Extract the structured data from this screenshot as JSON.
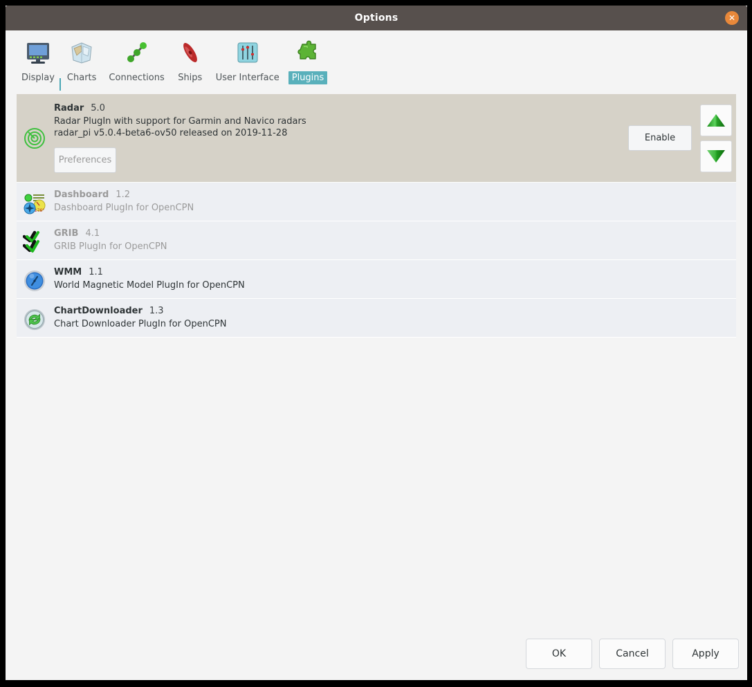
{
  "window": {
    "title": "Options",
    "close_label": "✕"
  },
  "toolbar": {
    "tabs": [
      {
        "label": "Display",
        "icon": "monitor-icon",
        "selected": false
      },
      {
        "label": "Charts",
        "icon": "charts-icon",
        "selected": false
      },
      {
        "label": "Connections",
        "icon": "connections-icon",
        "selected": false
      },
      {
        "label": "Ships",
        "icon": "ship-icon",
        "selected": false
      },
      {
        "label": "User Interface",
        "icon": "sliders-icon",
        "selected": false
      },
      {
        "label": "Plugins",
        "icon": "puzzle-piece-icon",
        "selected": true
      }
    ]
  },
  "plugins": [
    {
      "name": "Radar",
      "version": "5.0",
      "description": "Radar PlugIn with support for Garmin and Navico radars",
      "detail": "radar_pi v5.0.4-beta6-ov50 released on 2019-11-28",
      "icon": "radar-icon",
      "expanded": true,
      "enabled": false,
      "preferences_label": "Preferences",
      "preferences_enabled": false,
      "toggle_label": "Enable",
      "move_up_label": "▲",
      "move_down_label": "▼"
    },
    {
      "name": "Dashboard",
      "version": "1.2",
      "description": "Dashboard PlugIn for OpenCPN",
      "detail": "",
      "icon": "dashboard-icon",
      "expanded": false,
      "enabled": false
    },
    {
      "name": "GRIB",
      "version": "4.1",
      "description": "GRIB PlugIn for OpenCPN",
      "detail": "",
      "icon": "grib-icon",
      "expanded": false,
      "enabled": false
    },
    {
      "name": "WMM",
      "version": "1.1",
      "description": "World Magnetic Model PlugIn for OpenCPN",
      "detail": "",
      "icon": "wmm-compass-icon",
      "expanded": false,
      "enabled": true
    },
    {
      "name": "ChartDownloader",
      "version": "1.3",
      "description": "Chart Downloader PlugIn for OpenCPN",
      "detail": "",
      "icon": "chart-downloader-icon",
      "expanded": false,
      "enabled": true
    }
  ],
  "dialog_buttons": {
    "ok": "OK",
    "cancel": "Cancel",
    "apply": "Apply"
  },
  "colors": {
    "titlebar": "#57504d",
    "close_button": "#e8883a",
    "tab_selected": "#59b0bb",
    "expanded_row": "#d6d2c8",
    "row": "#edeff3",
    "window_bg": "#f4f4f4"
  }
}
